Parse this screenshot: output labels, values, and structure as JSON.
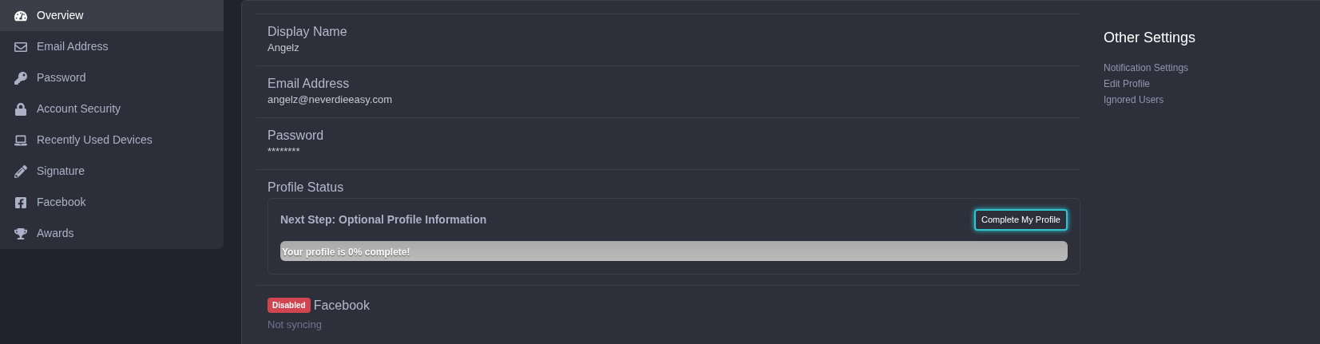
{
  "sidebar": {
    "items": [
      {
        "label": "Overview",
        "selected": true
      },
      {
        "label": "Email Address",
        "selected": false
      },
      {
        "label": "Password",
        "selected": false
      },
      {
        "label": "Account Security",
        "selected": false
      },
      {
        "label": "Recently Used Devices",
        "selected": false
      },
      {
        "label": "Signature",
        "selected": false
      },
      {
        "label": "Facebook",
        "selected": false
      },
      {
        "label": "Awards",
        "selected": false
      }
    ]
  },
  "fields": [
    {
      "label": "Display Name",
      "value": "Angelz"
    },
    {
      "label": "Email Address",
      "value": "angelz@neverdieeasy.com"
    },
    {
      "label": "Password",
      "value": "********"
    }
  ],
  "profile_status": {
    "title": "Profile Status",
    "next_step": "Next Step: Optional Profile Information",
    "button": "Complete My Profile",
    "progress": {
      "level": 0,
      "text": "Your profile is 0% complete!"
    }
  },
  "facebook": {
    "badge": "Disabled",
    "title": "Facebook",
    "status": "Not syncing"
  },
  "other_settings": {
    "title": "Other Settings",
    "links": [
      "Notification Settings",
      "Edit Profile",
      "Ignored Users"
    ]
  }
}
